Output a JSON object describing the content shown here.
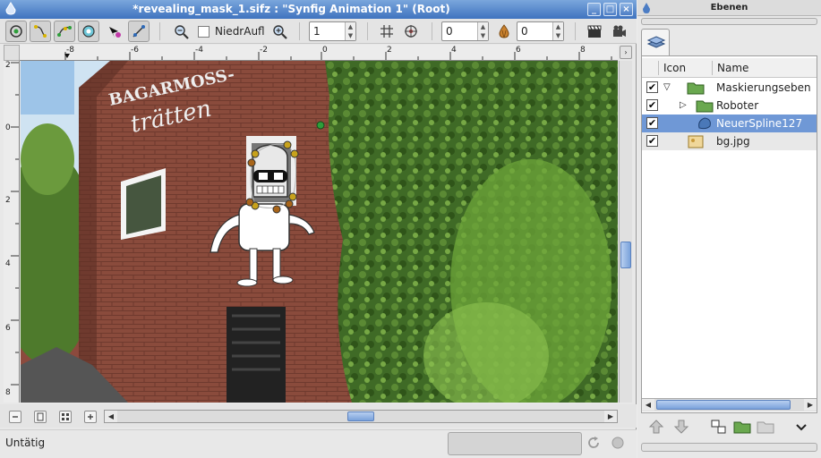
{
  "window": {
    "title": "*revealing_mask_1.sifz : \"Synfig Animation 1\" (Root)",
    "buttons": [
      "_",
      "□",
      "×"
    ]
  },
  "toolbar": {
    "tools": [
      "circle-tool-icon",
      "transform-tool-icon",
      "bline-tool-icon",
      "smooth-move-tool-icon",
      "draw-tool-icon",
      "sketch-tool-icon"
    ],
    "onion_label": "NiedrAufl",
    "resolution_value": "1",
    "past_keyframes_value": "0",
    "future_keyframes_value": "0"
  },
  "ruler": {
    "top_labels": [
      "-8",
      "-6",
      "-4",
      "-2",
      "0",
      "2",
      "4",
      "6",
      "8"
    ],
    "left_labels": [
      "2",
      "0",
      "2",
      "4",
      "6",
      "8"
    ]
  },
  "canvas": {
    "sign_line1": "BAGARMOSS-",
    "sign_line2": "trätten"
  },
  "status": {
    "text": "Untätig",
    "progress": 0.0
  },
  "layers_panel": {
    "title": "Ebenen",
    "columns": [
      "Icon",
      "Name"
    ],
    "layers": [
      {
        "name": "Maskierungseben",
        "checked": true,
        "expander": "expanded",
        "icon": "folder-icon"
      },
      {
        "name": "Roboter",
        "checked": true,
        "expander": "collapsed",
        "icon": "folder-icon"
      },
      {
        "name": "NeuerSpline127",
        "checked": true,
        "expander": "none",
        "icon": "spline-icon",
        "selected": true
      },
      {
        "name": "bg.jpg",
        "checked": true,
        "expander": "none",
        "icon": "image-icon"
      }
    ]
  }
}
